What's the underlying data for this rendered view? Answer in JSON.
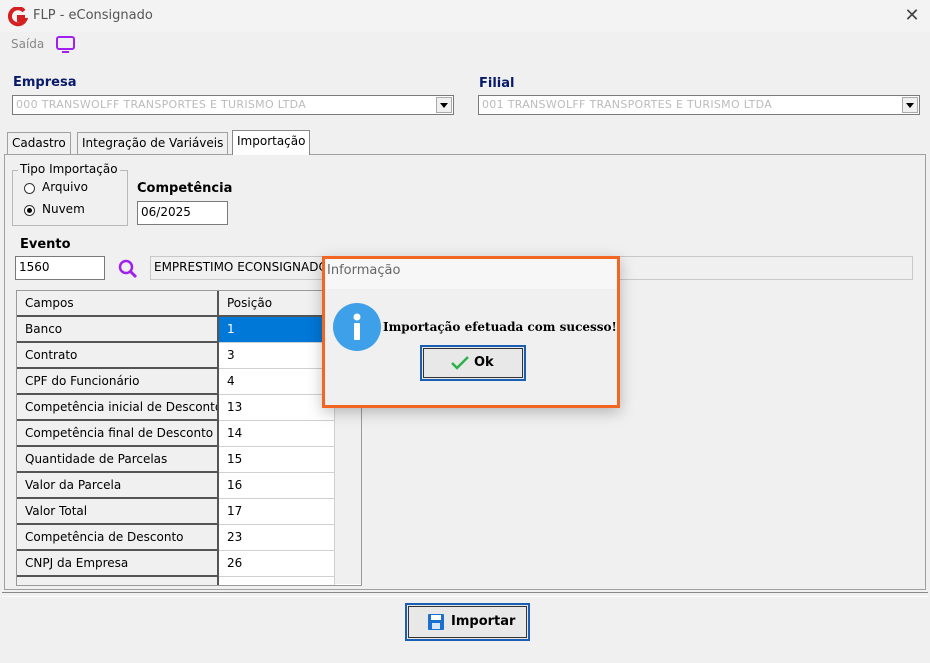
{
  "window": {
    "title": "FLP - eConsignado",
    "close_glyph": "✕"
  },
  "toolbar": {
    "saida_label": "Saída",
    "icon": "monitor-icon"
  },
  "empresa": {
    "label": "Empresa",
    "value": "000 TRANSWOLFF TRANSPORTES E TURISMO LTDA"
  },
  "filial": {
    "label": "Filial",
    "value": "001 TRANSWOLFF TRANSPORTES E TURISMO LTDA"
  },
  "tabs": [
    {
      "label": "Cadastro"
    },
    {
      "label": "Integração de Variáveis"
    },
    {
      "label": "Importação",
      "active": true
    }
  ],
  "tipo_importacao": {
    "title": "Tipo Importação",
    "options": [
      {
        "label": "Arquivo",
        "checked": false
      },
      {
        "label": "Nuvem",
        "checked": true
      }
    ]
  },
  "competencia": {
    "label": "Competência",
    "value": "06/2025"
  },
  "evento": {
    "label": "Evento",
    "code": "1560",
    "description": "EMPRESTIMO ECONSIGNADO"
  },
  "grid": {
    "headers": [
      "Campos",
      "Posição"
    ],
    "rows": [
      {
        "campo": "Banco",
        "posicao": "1"
      },
      {
        "campo": "Contrato",
        "posicao": "3"
      },
      {
        "campo": "CPF do Funcionário",
        "posicao": "4"
      },
      {
        "campo": "Competência inicial de Desconto",
        "posicao": "13"
      },
      {
        "campo": "Competência final de Desconto",
        "posicao": "14"
      },
      {
        "campo": "Quantidade de Parcelas",
        "posicao": "15"
      },
      {
        "campo": "Valor da Parcela",
        "posicao": "16"
      },
      {
        "campo": "Valor Total",
        "posicao": "17"
      },
      {
        "campo": "Competência de Desconto",
        "posicao": "23"
      },
      {
        "campo": "CNPJ da Empresa",
        "posicao": "26"
      }
    ]
  },
  "footer": {
    "import_label": "Importar",
    "import_icon": "save-disk-icon"
  },
  "dialog": {
    "title": "Informação",
    "message": "Importação efetuada com sucesso!",
    "ok_label": "Ok",
    "icon": "info-icon",
    "ok_icon": "checkmark-icon"
  },
  "colors": {
    "accent": "#0078d7",
    "dialog_border": "#f26522",
    "heading": "#0a1a6a",
    "purple_icon": "#a020f0"
  }
}
